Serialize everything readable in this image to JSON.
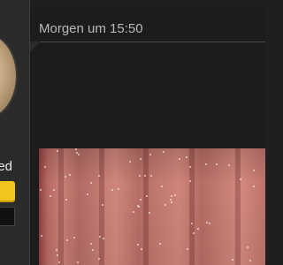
{
  "sidebar": {
    "status_label": "ed",
    "avatar_icon": "user-avatar",
    "accent_color": "#f2c51c"
  },
  "post": {
    "time_label": "Morgen um 15:50",
    "image_alt": "pink fabric curtain photo"
  },
  "colors": {
    "background": "#1e1e1e",
    "panel": "#1c1c1c",
    "sidebar": "#2b2b2b",
    "text_primary": "#e8e8e8",
    "text_secondary": "#b9b9b9",
    "accent": "#f2c51c"
  }
}
